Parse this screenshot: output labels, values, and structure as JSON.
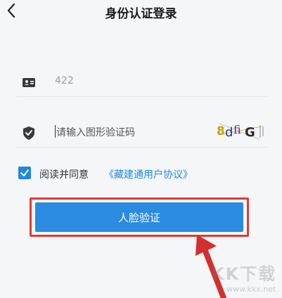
{
  "header": {
    "title": "身份认证登录",
    "back_icon": "back-icon"
  },
  "id_field": {
    "icon": "id-card-icon",
    "value": "422"
  },
  "captcha_field": {
    "icon": "shield-icon",
    "placeholder": "请输入图形验证码",
    "captcha_text": "8dfiG"
  },
  "agreement": {
    "checked": true,
    "text": "阅读并同意",
    "link_text": "《藏建通用户协议》"
  },
  "verify_button": {
    "label": "人脸验证"
  },
  "annotation": {
    "outline_color": "#e53935",
    "arrow_color": "#d32f2f"
  },
  "watermark": {
    "logo": "KK下载",
    "url": "www.kkx.net"
  },
  "colors": {
    "accent": "#2a8be0",
    "link": "#1e88e5"
  }
}
